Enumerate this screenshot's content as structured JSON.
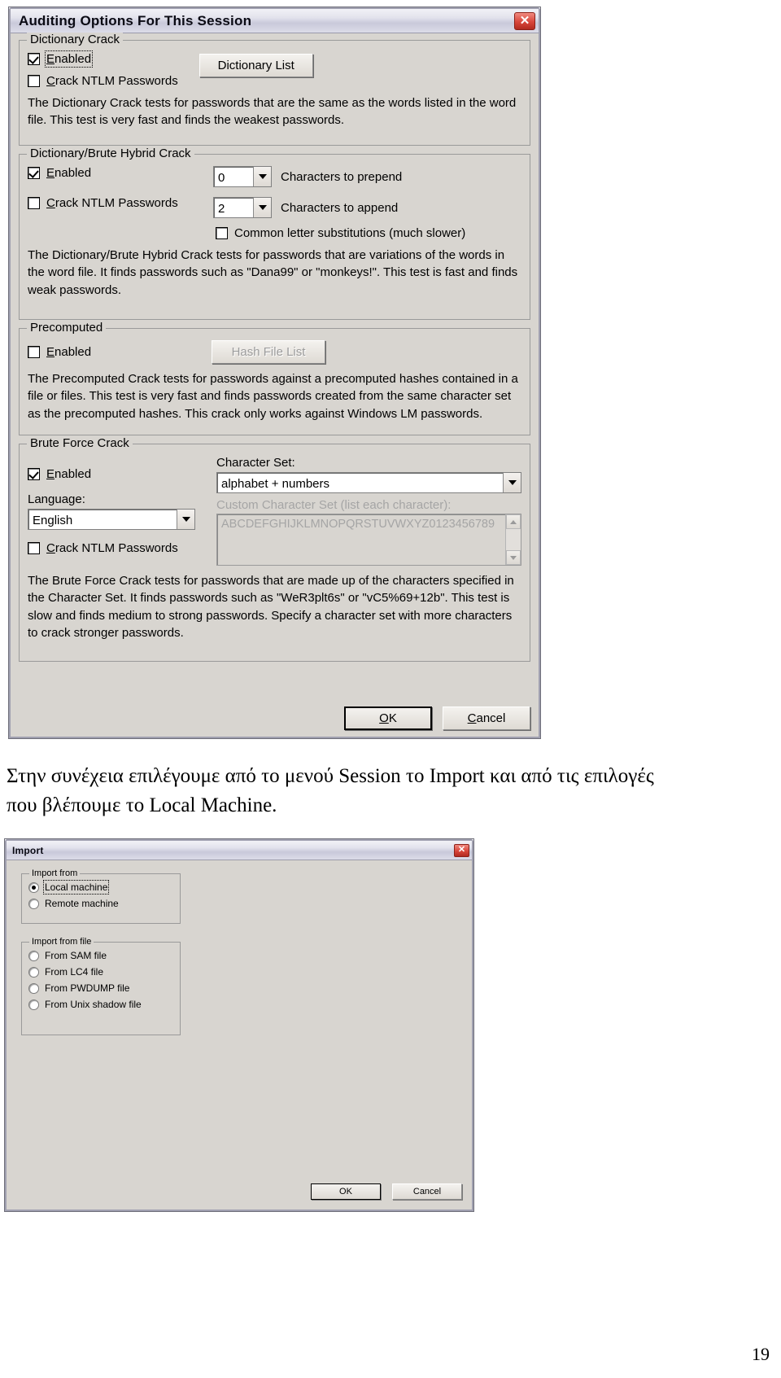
{
  "auditing_dialog": {
    "title": "Auditing Options For This Session",
    "close_icon": "close-icon",
    "dictionary_crack": {
      "legend": "Dictionary Crack",
      "enabled_label": "Enabled",
      "enabled_checked": true,
      "ntlm_label": "Crack NTLM Passwords",
      "ntlm_checked": false,
      "dictionary_list_button": "Dictionary List",
      "description": "The Dictionary Crack tests for passwords that are the same as the words listed in the word file.  This test is very fast and finds the weakest passwords."
    },
    "hybrid_crack": {
      "legend": "Dictionary/Brute Hybrid Crack",
      "enabled_label": "Enabled",
      "enabled_checked": true,
      "ntlm_label": "Crack NTLM Passwords",
      "ntlm_checked": false,
      "prepend_value": "0",
      "prepend_label": "Characters to prepend",
      "append_value": "2",
      "append_label": "Characters to append",
      "substitutions_label": "Common letter substitutions (much slower)",
      "substitutions_checked": false,
      "description": "The Dictionary/Brute Hybrid Crack tests for passwords that are variations of the words in the word file. It finds passwords such as \"Dana99\" or \"monkeys!\". This test is fast and finds weak passwords."
    },
    "precomputed": {
      "legend": "Precomputed",
      "enabled_label": "Enabled",
      "enabled_checked": false,
      "hash_file_list_button": "Hash File List",
      "hash_file_list_disabled": true,
      "description": "The Precomputed Crack tests for passwords against a precomputed hashes contained in a file or files. This test is very fast and finds passwords created from the same character set as the precomputed hashes. This crack only works against Windows LM passwords."
    },
    "brute_force": {
      "legend": "Brute Force Crack",
      "enabled_label": "Enabled",
      "enabled_checked": true,
      "language_caption": "Language:",
      "language_value": "English",
      "ntlm_label": "Crack NTLM Passwords",
      "ntlm_checked": false,
      "character_set_caption": "Character Set:",
      "character_set_value": "alphabet + numbers",
      "custom_set_caption": "Custom Character Set (list each character):",
      "custom_set_value": "ABCDEFGHIJKLMNOPQRSTUVWXYZ0123456789",
      "description": "The Brute Force Crack tests for passwords that are made up of the characters specified in the Character Set. It finds passwords such as \"WeR3plt6s\" or \"vC5%69+12b\". This test is slow and finds medium to strong passwords. Specify a character set with more characters to crack stronger passwords."
    },
    "ok_button": "OK",
    "ok_accel": "O",
    "ok_rest": "K",
    "cancel_button": "Cancel",
    "cancel_accel": "C",
    "cancel_rest": "ancel"
  },
  "body_text": {
    "line1": "Στην συνέχεια επιλέγουμε από το μενού Session το Import και από τις επιλογές",
    "line2": "που βλέπουμε το Local Machine."
  },
  "import_dialog": {
    "title": "Import",
    "close_icon": "close-icon",
    "import_from": {
      "legend": "Import from",
      "options": [
        {
          "label": "Local machine",
          "selected": true,
          "focused": true
        },
        {
          "label": "Remote machine",
          "selected": false,
          "focused": false
        }
      ]
    },
    "import_from_file": {
      "legend": "Import from file",
      "options": [
        {
          "label": "From SAM file",
          "selected": false
        },
        {
          "label": "From LC4 file",
          "selected": false
        },
        {
          "label": "From PWDUMP file",
          "selected": false
        },
        {
          "label": "From Unix shadow file",
          "selected": false
        }
      ]
    },
    "ok_button": "OK",
    "cancel_button": "Cancel"
  },
  "page_number": "19",
  "colors": {
    "dialog_face": "#d8d5d0",
    "title_gradient_top": "#f2f2f7",
    "close_red": "#d8453a",
    "disabled_text": "#a5a5a5"
  }
}
